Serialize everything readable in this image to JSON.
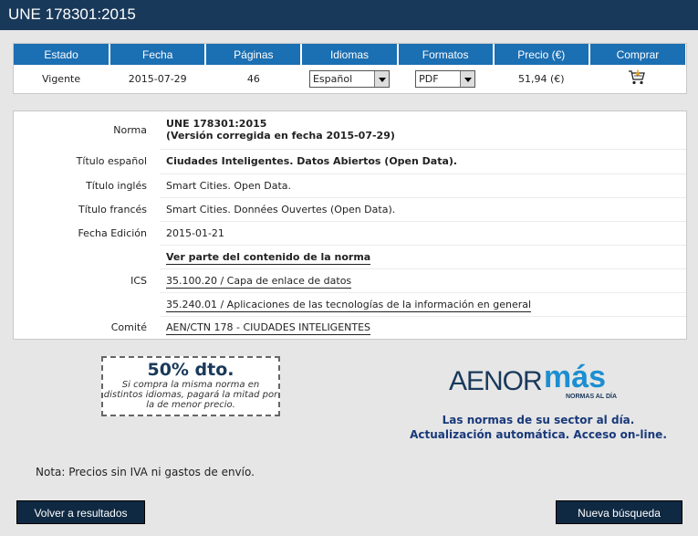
{
  "title": "UNE 178301:2015",
  "purchase": {
    "headers": [
      "Estado",
      "Fecha",
      "Páginas",
      "Idiomas",
      "Formatos",
      "Precio (€)",
      "Comprar"
    ],
    "estado": "Vigente",
    "fecha": "2015-07-29",
    "paginas": "46",
    "idioma": "Español",
    "formato": "PDF",
    "precio": "51,94 (€)",
    "cart_icon": "shopping-cart-icon"
  },
  "detail": {
    "norma_label": "Norma",
    "norma_code": "UNE 178301:2015",
    "norma_version": "(Versión corregida en fecha 2015-07-29)",
    "titulo_es_label": "Título español",
    "titulo_es": "Ciudades Inteligentes. Datos Abiertos (Open Data).",
    "titulo_en_label": "Título inglés",
    "titulo_en": "Smart Cities. Open Data.",
    "titulo_fr_label": "Título francés",
    "titulo_fr": "Smart Cities. Données Ouvertes (Open Data).",
    "fecha_label": "Fecha Edición",
    "fecha": "2015-01-21",
    "ver_link": "Ver parte del contenido de la norma",
    "ics_label": "ICS",
    "ics_1": "35.100.20 / Capa de enlace de datos",
    "ics_2": "35.240.01 / Aplicaciones de las tecnologías de la información en general",
    "comite_label": "Comité",
    "comite": "AEN/CTN 178 - CIUDADES INTELIGENTES"
  },
  "promo": {
    "big": "50% dto.",
    "small": "Si compra la misma norma en distintos idiomas, pagará la mitad por la de menor precio."
  },
  "logo": {
    "aenor": "AENOR",
    "mas": "más",
    "tagline": "NORMAS AL DÍA",
    "brand_color": "#19395a",
    "accent_color": "#1b8fd1"
  },
  "slogan": {
    "line1": "Las normas de su sector al día.",
    "line2": "Actualización automática. Acceso on-line."
  },
  "note": "Nota: Precios sin IVA ni gastos de envío.",
  "buttons": {
    "back": "Volver a resultados",
    "new_search": "Nueva búsqueda"
  }
}
